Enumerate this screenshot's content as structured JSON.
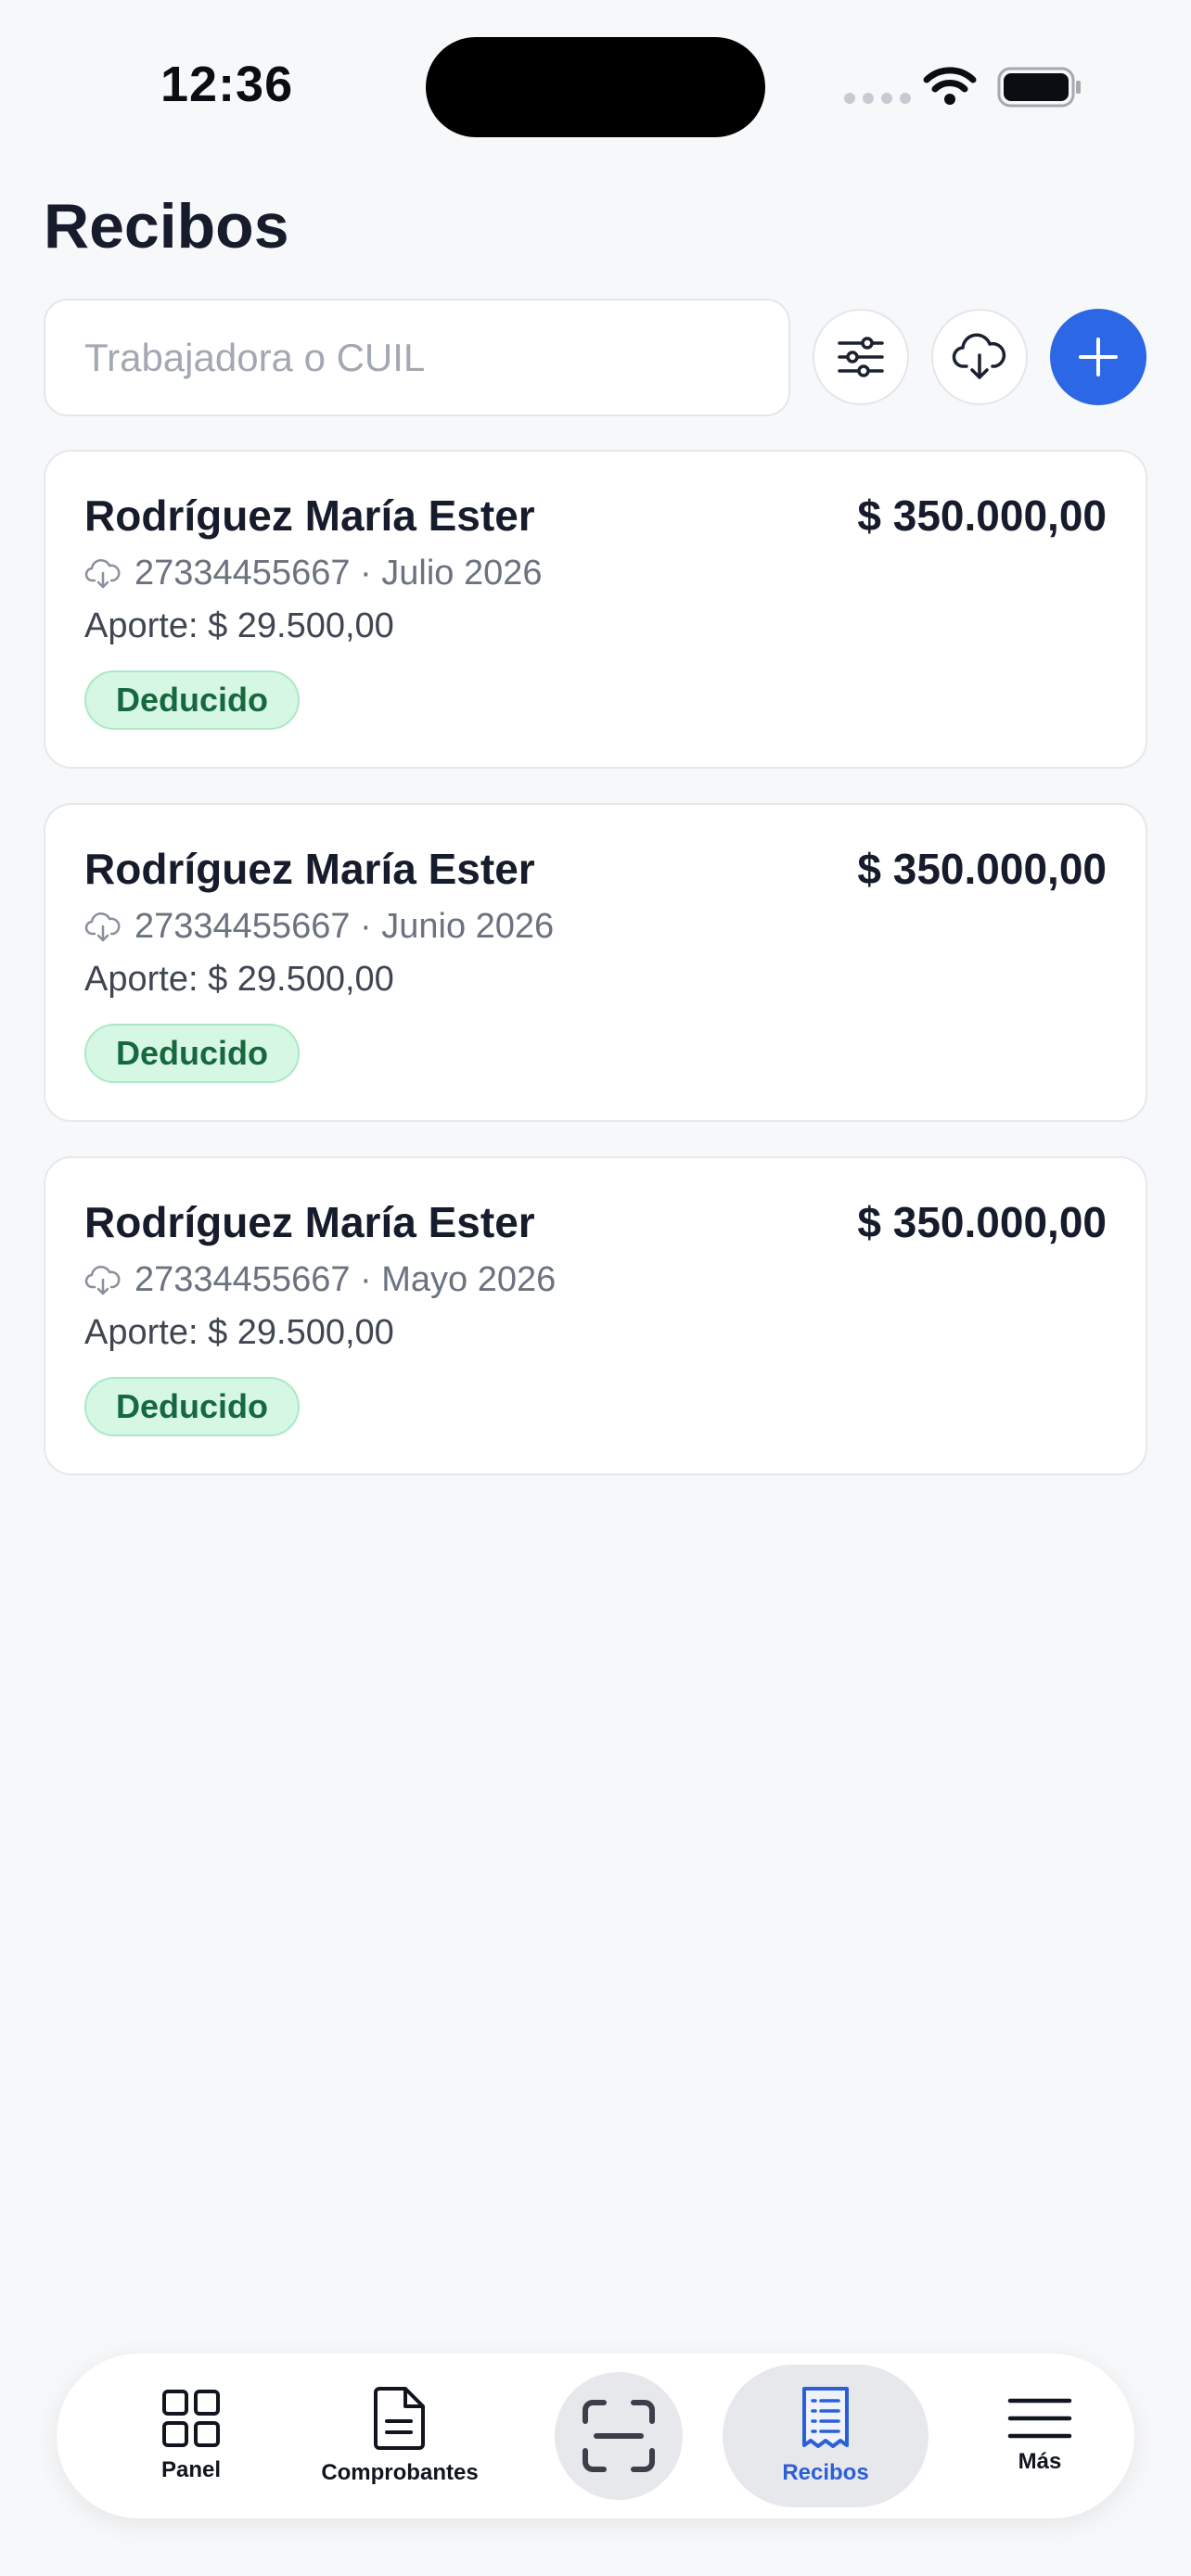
{
  "status_bar": {
    "time": "12:36"
  },
  "header": {
    "title": "Recibos"
  },
  "search": {
    "placeholder": "Trabajadora o CUIL",
    "value": ""
  },
  "accent_color": "#2c67e5",
  "receipts": [
    {
      "name": "Rodríguez María Ester",
      "amount": "$ 350.000,00",
      "cuil": "27334455667",
      "period": "Julio 2026",
      "meta": "27334455667 · Julio 2026",
      "contribution": "Aporte: $ 29.500,00",
      "status": "Deducido"
    },
    {
      "name": "Rodríguez María Ester",
      "amount": "$ 350.000,00",
      "cuil": "27334455667",
      "period": "Junio 2026",
      "meta": "27334455667 · Junio 2026",
      "contribution": "Aporte: $ 29.500,00",
      "status": "Deducido"
    },
    {
      "name": "Rodríguez María Ester",
      "amount": "$ 350.000,00",
      "cuil": "27334455667",
      "period": "Mayo 2026",
      "meta": "27334455667 · Mayo 2026",
      "contribution": "Aporte: $ 29.500,00",
      "status": "Deducido"
    }
  ],
  "nav": {
    "items": [
      {
        "label": "Panel",
        "icon": "grid-icon",
        "active": false
      },
      {
        "label": "Comprobantes",
        "icon": "document-icon",
        "active": false
      },
      {
        "label": "",
        "icon": "scan-icon",
        "active": false
      },
      {
        "label": "Recibos",
        "icon": "receipt-icon",
        "active": true
      },
      {
        "label": "Más",
        "icon": "menu-icon",
        "active": false
      }
    ]
  }
}
